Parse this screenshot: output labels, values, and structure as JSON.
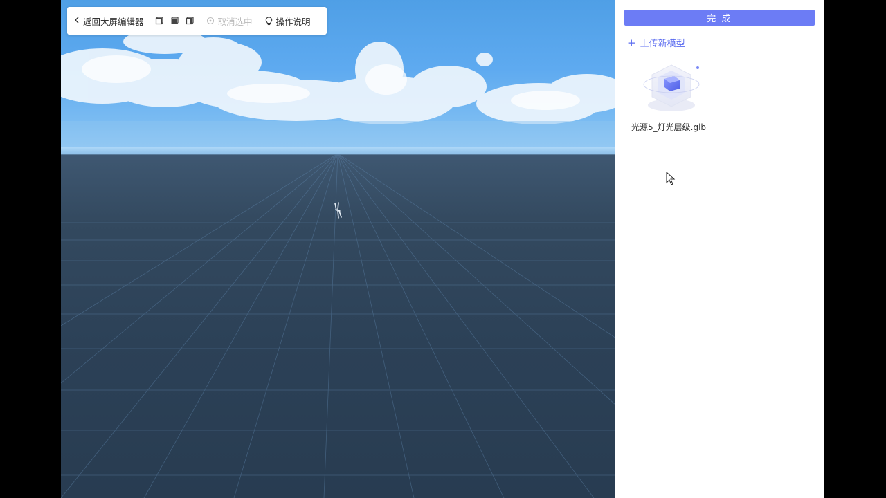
{
  "toolbar": {
    "back_label": "返回大屏编辑器",
    "cancel_label": "取消选中",
    "help_label": "操作说明",
    "icons": [
      "box-outline-icon",
      "box-solid-icon",
      "box-side-icon"
    ]
  },
  "panel": {
    "done_label": "完 成",
    "upload_label": "上传新模型",
    "models": [
      {
        "name": "光源5_灯光层级.glb"
      }
    ]
  },
  "colors": {
    "accent": "#6c7cf5",
    "link": "#5b6cf0",
    "sky": "#5eaaf0",
    "ground": "#2c4157"
  }
}
